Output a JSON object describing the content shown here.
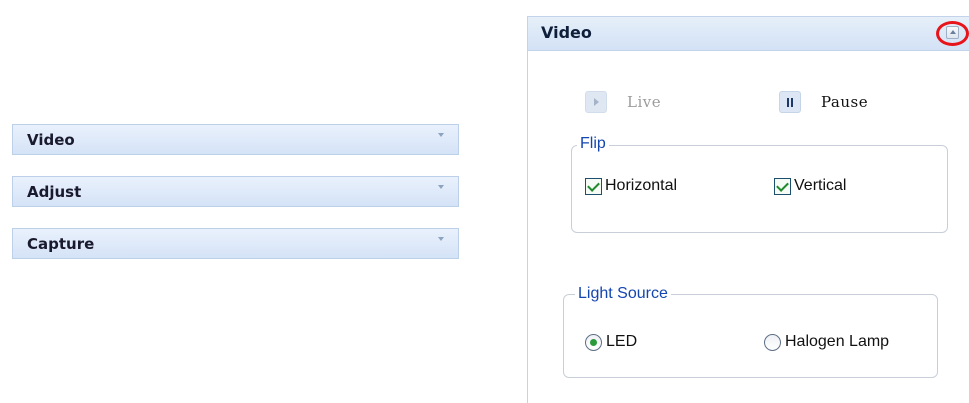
{
  "left_accordion": {
    "sections": [
      {
        "label": "Video"
      },
      {
        "label": "Adjust"
      },
      {
        "label": "Capture"
      }
    ]
  },
  "video_panel": {
    "title": "Video",
    "collapse_icon": "chevron-up-icon",
    "controls": {
      "live_label": "Live",
      "pause_label": "Pause"
    },
    "flip": {
      "legend": "Flip",
      "horizontal": {
        "label": "Horizontal",
        "checked": true
      },
      "vertical": {
        "label": "Vertical",
        "checked": true
      }
    },
    "light_source": {
      "legend": "Light Source",
      "led": {
        "label": "LED",
        "selected": true
      },
      "halogen": {
        "label": "Halogen Lamp",
        "selected": false
      }
    }
  },
  "colors": {
    "header_gradient_top": "#e6eff9",
    "header_gradient_bottom": "#d3e2f6",
    "legend_text": "#1346b0",
    "highlight_ring": "#e8141b",
    "check_green": "#1f8a2c"
  }
}
